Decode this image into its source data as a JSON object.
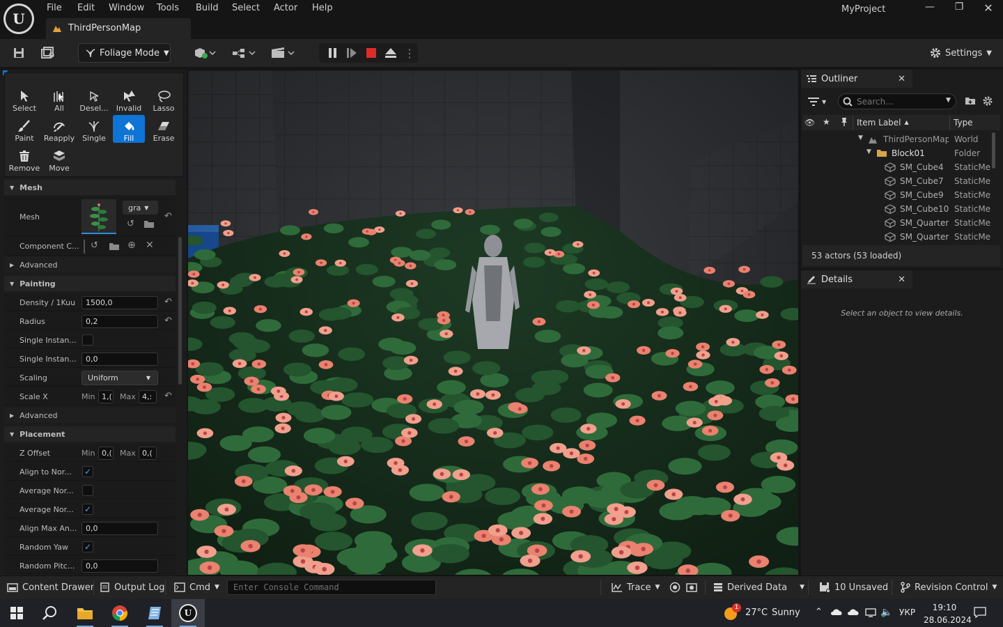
{
  "menu": [
    "File",
    "Edit",
    "Window",
    "Tools",
    "Build",
    "Select",
    "Actor",
    "Help"
  ],
  "map_tab": "ThirdPersonMap",
  "project_name": "MyProject",
  "toolbar": {
    "mode_label": "Foliage Mode",
    "settings_label": "Settings"
  },
  "tools": [
    {
      "label": "Select",
      "icon": "cursor-icon",
      "active": false
    },
    {
      "label": "All",
      "icon": "select-all-icon",
      "active": false
    },
    {
      "label": "Desel...",
      "icon": "deselect-icon",
      "active": false
    },
    {
      "label": "Invalid",
      "icon": "invalid-icon",
      "active": false
    },
    {
      "label": "Lasso",
      "icon": "lasso-icon",
      "active": false
    },
    {
      "label": "Paint",
      "icon": "paint-brush-icon",
      "active": false
    },
    {
      "label": "Reapply",
      "icon": "reapply-icon",
      "active": false
    },
    {
      "label": "Single",
      "icon": "single-plant-icon",
      "active": false
    },
    {
      "label": "Fill",
      "icon": "fill-bucket-icon",
      "active": true
    },
    {
      "label": "Erase",
      "icon": "eraser-icon",
      "active": false
    },
    {
      "label": "Remove",
      "icon": "trash-icon",
      "active": false
    },
    {
      "label": "Move",
      "icon": "move-icon",
      "active": false
    }
  ],
  "details_left": {
    "mesh_section": "Mesh",
    "mesh_label": "Mesh",
    "mesh_dropdown": "gra",
    "component_label": "Component C...",
    "advanced1": "Advanced",
    "painting_section": "Painting",
    "density_label": "Density / 1Kuu",
    "density_value": "1500,0",
    "radius_label": "Radius",
    "radius_value": "0,2",
    "single_inst1_label": "Single Instan...",
    "single_inst2_label": "Single Instan...",
    "single_inst2_value": "0,0",
    "scaling_label": "Scaling",
    "scaling_value": "Uniform",
    "scalex_label": "Scale X",
    "min_label": "Min",
    "max_label": "Max",
    "scalex_min": "1,(",
    "scalex_max": "4,:",
    "advanced2": "Advanced",
    "placement_section": "Placement",
    "zoffset_label": "Z Offset",
    "zoffset_min": "0,(",
    "zoffset_max": "0,(",
    "align_label": "Align to Nor...",
    "avg1_label": "Average Nor...",
    "avg2_label": "Average Nor...",
    "alignmax_label": "Align Max An...",
    "alignmax_value": "0,0",
    "randyaw_label": "Random Yaw",
    "randpitch_label": "Random Pitc...",
    "randpitch_value": "0,0"
  },
  "outliner": {
    "title": "Outliner",
    "search_placeholder": "Search...",
    "col_label": "Item Label",
    "col_type": "Type",
    "rows": [
      {
        "name": "ThirdPersonMap",
        "type": "World",
        "indent": 0
      },
      {
        "name": "Block01",
        "type": "Folder",
        "indent": 1
      },
      {
        "name": "SM_Cube4",
        "type": "StaticMe",
        "indent": 2
      },
      {
        "name": "SM_Cube7",
        "type": "StaticMe",
        "indent": 2
      },
      {
        "name": "SM_Cube9",
        "type": "StaticMe",
        "indent": 2
      },
      {
        "name": "SM_Cube10",
        "type": "StaticMe",
        "indent": 2
      },
      {
        "name": "SM_Quarter(",
        "type": "StaticMe",
        "indent": 2
      },
      {
        "name": "SM_Quarter(",
        "type": "StaticMe",
        "indent": 2
      }
    ],
    "footer": "53 actors (53 loaded)"
  },
  "details": {
    "title": "Details",
    "empty_msg": "Select an object to view details."
  },
  "statusbar": {
    "content_drawer": "Content Drawer",
    "output_log": "Output Log",
    "cmd": "Cmd",
    "console_placeholder": "Enter Console Command",
    "trace": "Trace",
    "derived_data": "Derived Data",
    "unsaved": "10 Unsaved",
    "revision_control": "Revision Control"
  },
  "taskbar": {
    "weather_temp": "27°C",
    "weather_desc": "Sunny",
    "weather_badge": "1",
    "lang": "УКР",
    "time": "19:10",
    "date": "28.06.2024"
  },
  "colors": {
    "accent": "#0e74d6",
    "stop": "#e02b2b",
    "panel": "#1c1c1c",
    "viewport_floor": "#1e3a26"
  }
}
